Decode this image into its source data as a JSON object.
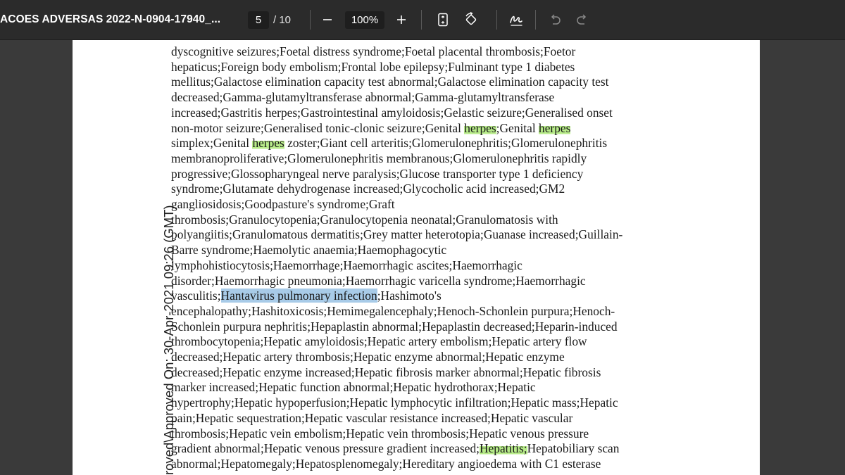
{
  "toolbar": {
    "doc_title": "ACOES ADVERSAS 2022-N-0904-17940_...",
    "page_number": "5",
    "page_total": "/ 10",
    "zoom": "100%"
  },
  "document": {
    "side_stamp": "roved\\Approved On: 30-Apr-2021 09:26 (GMT)",
    "lines": [
      [
        {
          "t": "dyscognitive seizures;Foetal distress syndrome;Foetal placental thrombosis;Foetor"
        }
      ],
      [
        {
          "t": "hepaticus;Foreign body embolism;Frontal lobe epilepsy;Fulminant type 1 diabetes"
        }
      ],
      [
        {
          "t": "mellitus;Galactose elimination capacity test abnormal;Galactose elimination capacity test"
        }
      ],
      [
        {
          "t": "decreased;Gamma-glutamyltransferase abnormal;Gamma-glutamyltransferase"
        }
      ],
      [
        {
          "t": "increased;Gastritis herpes;Gastrointestinal amyloidosis;Gelastic seizure;Generalised onset"
        }
      ],
      [
        {
          "t": "non-motor seizure;Generalised tonic-clonic seizure;Genital "
        },
        {
          "t": "herpes",
          "hl": "green"
        },
        {
          "t": ";Genital "
        },
        {
          "t": "herpes",
          "hl": "green"
        }
      ],
      [
        {
          "t": "simplex;Genital "
        },
        {
          "t": "herpes",
          "hl": "green"
        },
        {
          "t": " zoster;Giant cell arteritis;Glomerulonephritis;Glomerulonephritis"
        }
      ],
      [
        {
          "t": "membranoproliferative;Glomerulonephritis membranous;Glomerulonephritis rapidly"
        }
      ],
      [
        {
          "t": "progressive;Glossopharyngeal nerve paralysis;Glucose transporter type 1 deficiency"
        }
      ],
      [
        {
          "t": "syndrome;Glutamate dehydrogenase increased;Glycocholic acid increased;GM2"
        }
      ],
      [
        {
          "t": "gangliosidosis;Goodpasture's syndrome;Graft"
        }
      ],
      [
        {
          "t": "thrombosis;Granulocytopenia;Granulocytopenia neonatal;Granulomatosis with"
        }
      ],
      [
        {
          "t": "polyangiitis;Granulomatous dermatitis;Grey matter heterotopia;Guanase increased;Guillain-"
        }
      ],
      [
        {
          "t": "Barre syndrome;Haemolytic anaemia;Haemophagocytic"
        }
      ],
      [
        {
          "t": "lymphohistiocytosis;Haemorrhage;Haemorrhagic ascites;Haemorrhagic"
        }
      ],
      [
        {
          "t": "disorder;Haemorrhagic pneumonia;Haemorrhagic varicella syndrome;Haemorrhagic"
        }
      ],
      [
        {
          "t": "vasculitis;"
        },
        {
          "t": "Hantavirus pulmonary infection",
          "hl": "blue"
        },
        {
          "t": ";Hashimoto's"
        }
      ],
      [
        {
          "t": "encephalopathy;Hashitoxicosis;Hemimegalencephaly;Henoch-Schonlein purpura;Henoch-"
        }
      ],
      [
        {
          "t": "Schonlein purpura nephritis;Hepaplastin abnormal;Hepaplastin decreased;Heparin-induced"
        }
      ],
      [
        {
          "t": "thrombocytopenia;Hepatic amyloidosis;Hepatic artery embolism;Hepatic artery flow"
        }
      ],
      [
        {
          "t": "decreased;Hepatic artery thrombosis;Hepatic enzyme abnormal;Hepatic enzyme"
        }
      ],
      [
        {
          "t": "decreased;Hepatic enzyme increased;Hepatic fibrosis marker abnormal;Hepatic fibrosis"
        }
      ],
      [
        {
          "t": "marker increased;Hepatic function abnormal;Hepatic hydrothorax;Hepatic"
        }
      ],
      [
        {
          "t": "hypertrophy;Hepatic hypoperfusion;Hepatic lymphocytic infiltration;Hepatic mass;Hepatic"
        }
      ],
      [
        {
          "t": "pain;Hepatic sequestration;Hepatic vascular resistance increased;Hepatic vascular"
        }
      ],
      [
        {
          "t": "thrombosis;Hepatic vein embolism;Hepatic vein thrombosis;Hepatic venous pressure"
        }
      ],
      [
        {
          "t": "gradient abnormal;Hepatic venous pressure gradient increased;"
        },
        {
          "t": "Hepatitis;",
          "hl": "green"
        },
        {
          "t": "Hepatobiliary scan"
        }
      ],
      [
        {
          "t": "abnormal;Hepatomegaly;Hepatosplenomegaly;Hereditary angioedema with C1 esterase"
        }
      ]
    ]
  },
  "icons": {
    "zoom_out": "minus-icon",
    "zoom_in": "plus-icon",
    "fit": "fit-page-icon",
    "rotate": "rotate-icon",
    "draw": "draw-icon",
    "undo": "undo-icon",
    "redo": "redo-icon"
  },
  "colors": {
    "toolbar_bg": "#2b2b2b",
    "viewer_bg": "#3a3a3a",
    "highlight_green": "#b8ec8a",
    "highlight_blue": "#a8cbe8"
  }
}
